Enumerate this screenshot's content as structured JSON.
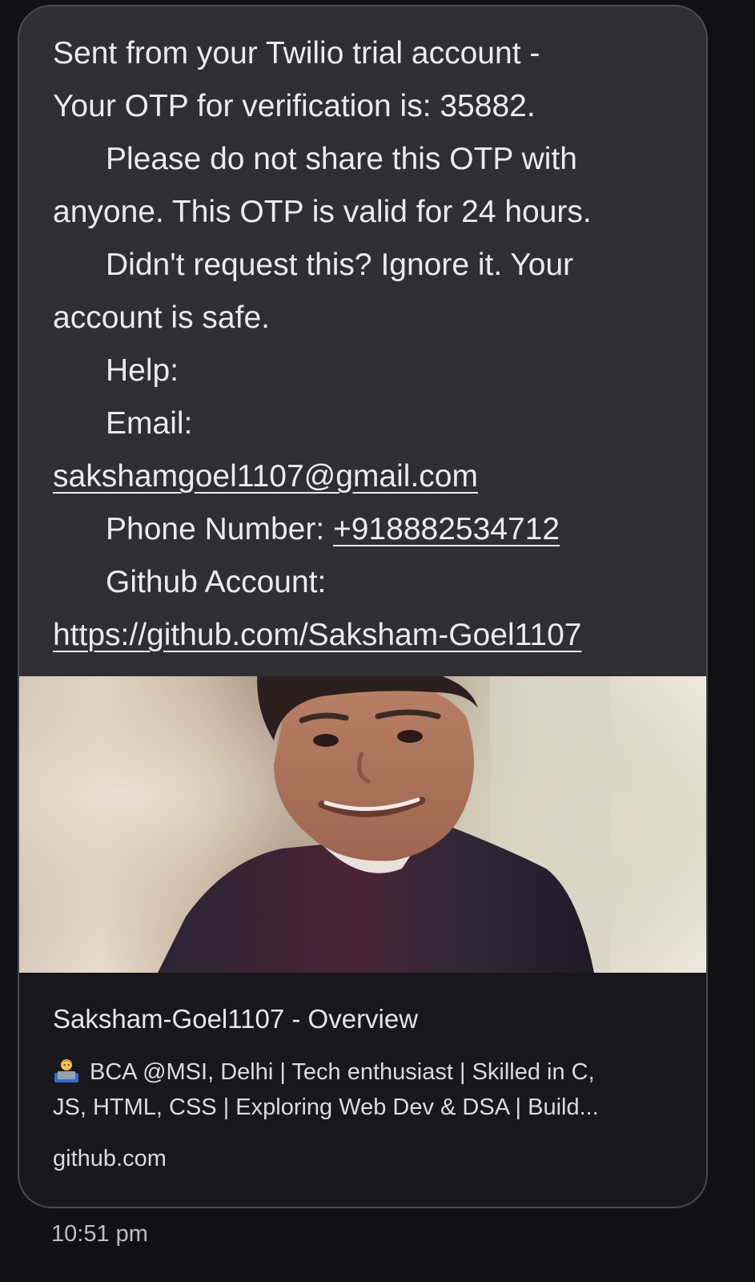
{
  "message": {
    "lines": [
      "Sent from your Twilio trial account -",
      "Your OTP for verification is: 35882.",
      "Please do not share this OTP with",
      "anyone. This OTP is valid for 24 hours.",
      "Didn't request this? Ignore it. Your",
      "account is safe.",
      "Help:",
      "Email:"
    ],
    "email": "sakshamgoel1107@gmail.com",
    "phone_label": "Phone Number: ",
    "phone": "+918882534712",
    "github_label": "Github Account:",
    "github_url": "https://github.com/Saksham-Goel1107"
  },
  "link_preview": {
    "title": "Saksham-Goel1107 - Overview",
    "description_line1": "BCA @MSI, Delhi | Tech enthusiast | Skilled in C,",
    "description_line2": "JS, HTML, CSS | Exploring Web Dev & DSA | Build...",
    "domain": "github.com",
    "emoji_icon": "technologist-emoji-icon"
  },
  "timestamp": "10:51 pm",
  "colors": {
    "background": "#111114",
    "bubble": "#2e2e33",
    "preview_card": "#18171c",
    "text": "#ebebef"
  }
}
